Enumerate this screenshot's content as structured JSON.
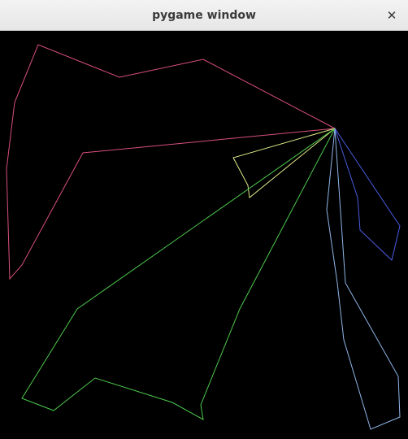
{
  "window": {
    "title": "pygame window",
    "close_glyph": "✕"
  },
  "canvas": {
    "background": "#000000",
    "shapes": [
      {
        "name": "pink-polygon",
        "color": "#d9507a"
      },
      {
        "name": "yellow-polygon",
        "color": "#dfe887"
      },
      {
        "name": "green-polygon",
        "color": "#4cc94c"
      },
      {
        "name": "blue-polygon",
        "color": "#4b5be0"
      },
      {
        "name": "light-blue-polygon",
        "color": "#8fb6e8"
      }
    ]
  }
}
